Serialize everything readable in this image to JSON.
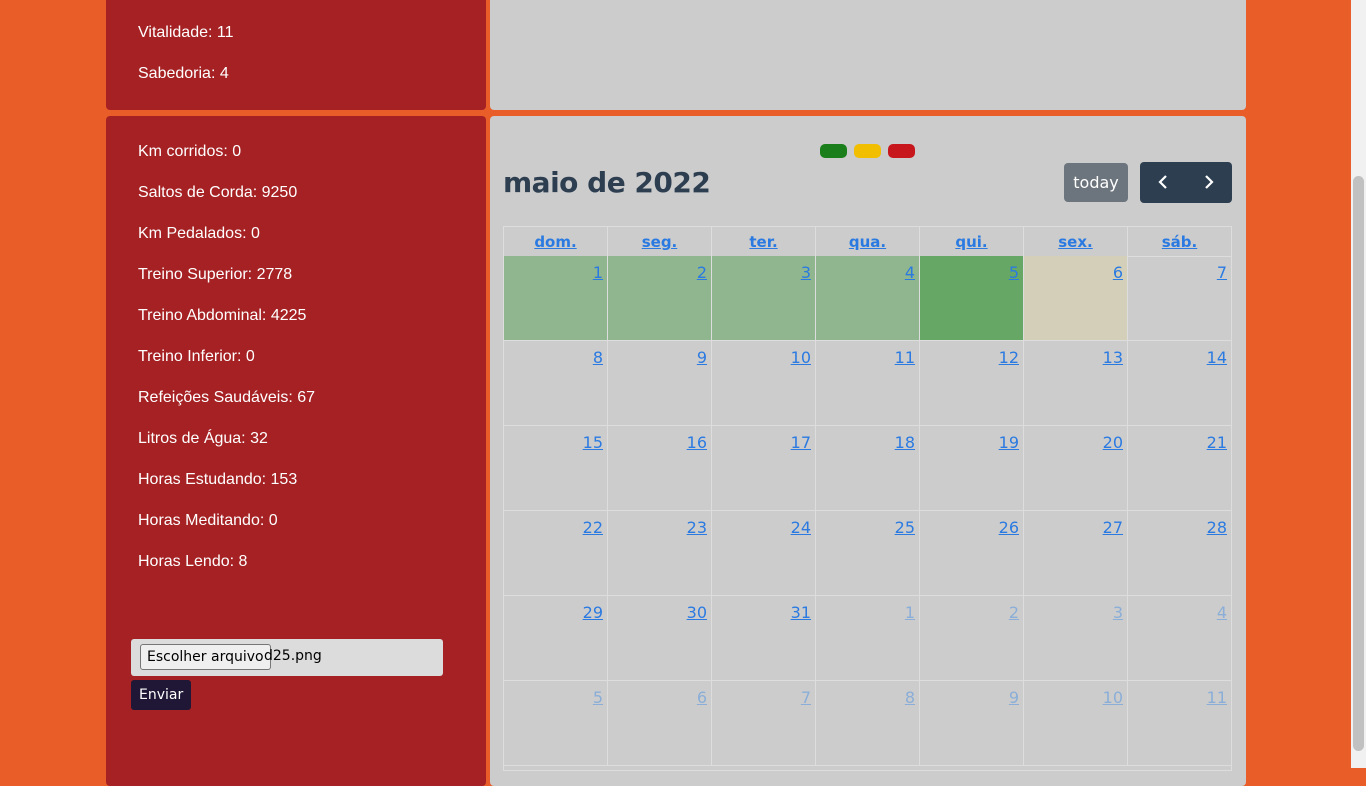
{
  "stats_top": [
    {
      "label": "Vitalidade: 11"
    },
    {
      "label": "Sabedoria: 4"
    }
  ],
  "stats": [
    {
      "label": "Km corridos: 0"
    },
    {
      "label": "Saltos de Corda: 9250"
    },
    {
      "label": "Km Pedalados: 0"
    },
    {
      "label": "Treino Superior: 2778"
    },
    {
      "label": "Treino Abdominal: 4225"
    },
    {
      "label": "Treino Inferior: 0"
    },
    {
      "label": "Refeições Saudáveis: 67"
    },
    {
      "label": "Litros de Água: 32"
    },
    {
      "label": "Horas Estudando: 153"
    },
    {
      "label": "Horas Meditando: 0"
    },
    {
      "label": "Horas Lendo: 8"
    }
  ],
  "upload": {
    "choose_label": "Escolher arquivo",
    "file_name": "d25.png",
    "submit_label": "Enviar"
  },
  "legend": [
    {
      "color": "#1a7f1a"
    },
    {
      "color": "#f2be00"
    },
    {
      "color": "#c8161d"
    }
  ],
  "calendar": {
    "title": "maio de 2022",
    "today_label": "today",
    "prev_icon": "chevron-left-icon",
    "next_icon": "chevron-right-icon",
    "weekdays": [
      "dom.",
      "seg.",
      "ter.",
      "qua.",
      "qui.",
      "sex.",
      "sáb."
    ],
    "weeks": [
      [
        {
          "d": "1",
          "c": "#8fb68f"
        },
        {
          "d": "2",
          "c": "#8fb68f"
        },
        {
          "d": "3",
          "c": "#8fb68f"
        },
        {
          "d": "4",
          "c": "#8fb68f"
        },
        {
          "d": "5",
          "c": "#66a766"
        },
        {
          "d": "6",
          "c": "#d3cfb8"
        },
        {
          "d": "7"
        }
      ],
      [
        {
          "d": "8"
        },
        {
          "d": "9"
        },
        {
          "d": "10"
        },
        {
          "d": "11"
        },
        {
          "d": "12"
        },
        {
          "d": "13"
        },
        {
          "d": "14"
        }
      ],
      [
        {
          "d": "15"
        },
        {
          "d": "16"
        },
        {
          "d": "17"
        },
        {
          "d": "18"
        },
        {
          "d": "19"
        },
        {
          "d": "20"
        },
        {
          "d": "21"
        }
      ],
      [
        {
          "d": "22"
        },
        {
          "d": "23"
        },
        {
          "d": "24"
        },
        {
          "d": "25"
        },
        {
          "d": "26"
        },
        {
          "d": "27"
        },
        {
          "d": "28"
        }
      ],
      [
        {
          "d": "29"
        },
        {
          "d": "30"
        },
        {
          "d": "31"
        },
        {
          "d": "1",
          "other": true
        },
        {
          "d": "2",
          "other": true
        },
        {
          "d": "3",
          "other": true
        },
        {
          "d": "4",
          "other": true
        }
      ],
      [
        {
          "d": "5",
          "other": true
        },
        {
          "d": "6",
          "other": true
        },
        {
          "d": "7",
          "other": true
        },
        {
          "d": "8",
          "other": true
        },
        {
          "d": "9",
          "other": true
        },
        {
          "d": "10",
          "other": true
        },
        {
          "d": "11",
          "other": true
        }
      ]
    ]
  }
}
